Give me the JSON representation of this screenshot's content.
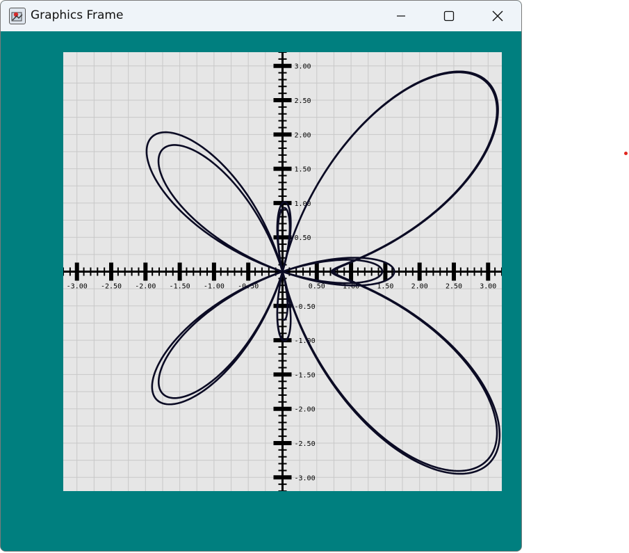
{
  "window": {
    "title": "Graphics Frame",
    "icons": {
      "app": "java-app-icon",
      "minimize": "minimize-icon",
      "maximize": "maximize-icon",
      "close": "close-icon"
    }
  },
  "colors": {
    "frame_background": "#007f7f",
    "plot_background": "#e6e6e6",
    "grid": "#c8c8c8",
    "axis": "#000000",
    "curve": "#0b0b24",
    "titlebar": "#eff4f9",
    "marker": "#e0261f"
  },
  "chart_data": {
    "type": "line",
    "title": "",
    "xlabel": "",
    "ylabel": "",
    "xlim": [
      -3.2,
      3.2
    ],
    "ylim": [
      -3.2,
      3.2
    ],
    "grid": true,
    "x_tick_labels": [
      "-3.00",
      "-2.50",
      "-2.00",
      "-1.50",
      "-1.00",
      "-0.50",
      "0.50",
      "1.00",
      "1.50",
      "2.00",
      "2.50",
      "3.00"
    ],
    "y_tick_labels": [
      "3.00",
      "2.50",
      "2.00",
      "1.50",
      "1.00",
      "0.50",
      "-0.50",
      "-1.00",
      "-1.50",
      "-2.00",
      "-2.50",
      "-3.00"
    ],
    "major_tick_step": 0.5,
    "minor_tick_step": 0.1,
    "series": [
      {
        "curve": "butterfly",
        "equation": "r = e^(sin t) - 2cos(4t) + sin^5((2t - pi)/24)",
        "t_range": [
          0,
          12.566
        ],
        "points": 2000
      }
    ]
  }
}
